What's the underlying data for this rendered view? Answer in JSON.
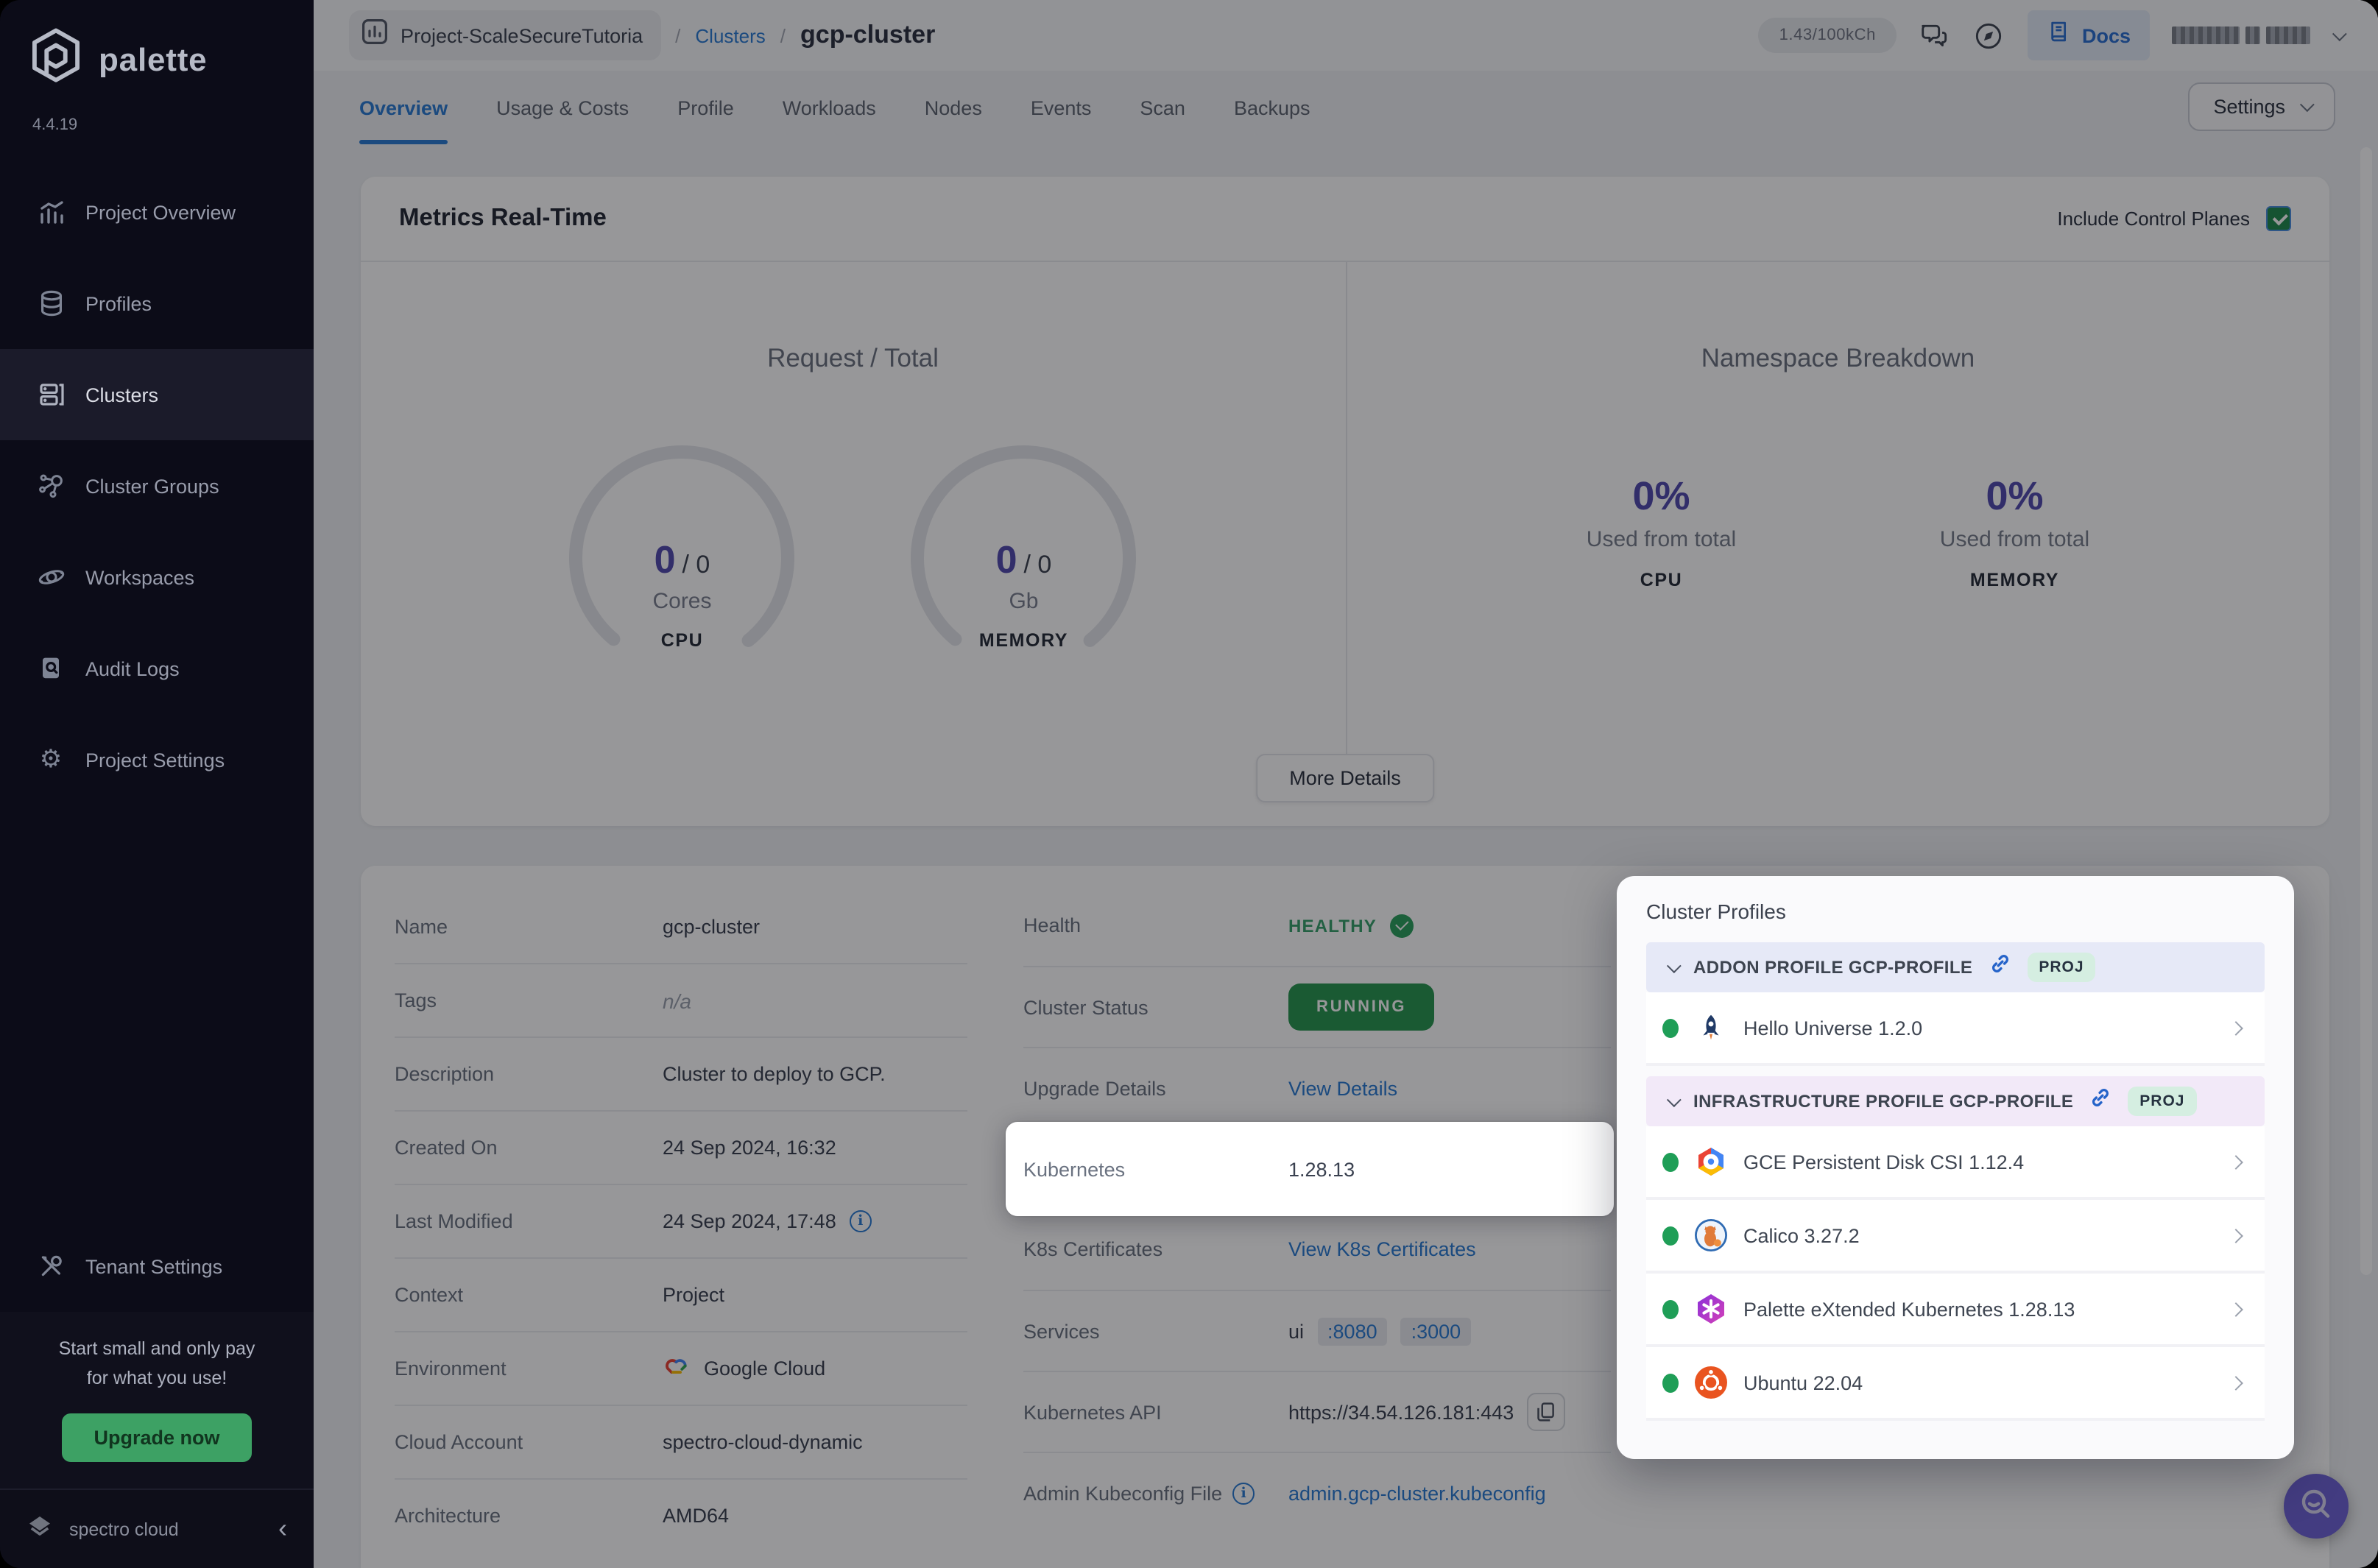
{
  "colors": {
    "accent_blue": "#2a7bd2",
    "brand_purple": "#514aae",
    "healthy_green": "#37a06b",
    "running_badge_green": "#289650",
    "sidebar_bg": "#0c0c18",
    "upgrade_green": "#3da164",
    "fab_purple": "#6e63d6",
    "addon_header_bg": "#e6e9f7",
    "infra_header_bg": "#f2e9f8",
    "proj_badge_bg": "#d5eee1"
  },
  "icons": {
    "fab": "magnifier-with-smile",
    "docs": "book",
    "topbar_left": "bar-chart-in-square",
    "topbar_chat": "chat-bubbles",
    "topbar_help": "compass",
    "kubernetes_api_action": "copy",
    "last_modified": "info-circle",
    "kubeconfig": "info-circle",
    "environment": "google-cloud-logo"
  },
  "brand": {
    "name": "palette",
    "version": "4.4.19",
    "footer": "spectro cloud",
    "collapse_icon": "‹"
  },
  "topbar": {
    "project": "Project-ScaleSecureTutoria",
    "sep1": "/",
    "clusters_link": "Clusters",
    "sep2": "/",
    "page_title": "gcp-cluster",
    "usage": "1.43/100kCh",
    "docs_label": "Docs"
  },
  "tabs": {
    "items": [
      {
        "label": "Overview"
      },
      {
        "label": "Usage & Costs"
      },
      {
        "label": "Profile"
      },
      {
        "label": "Workloads"
      },
      {
        "label": "Nodes"
      },
      {
        "label": "Events"
      },
      {
        "label": "Scan"
      },
      {
        "label": "Backups"
      }
    ],
    "settings_label": "Settings"
  },
  "sidebar": {
    "items": [
      {
        "label": "Project Overview"
      },
      {
        "label": "Profiles"
      },
      {
        "label": "Clusters"
      },
      {
        "label": "Cluster Groups"
      },
      {
        "label": "Workspaces"
      },
      {
        "label": "Audit Logs"
      },
      {
        "label": "Project Settings"
      },
      {
        "label": "Tenant Settings"
      }
    ],
    "promo_line1": "Start small and only pay",
    "promo_line2": "for what you use!",
    "upgrade_label": "Upgrade now"
  },
  "metrics": {
    "title": "Metrics Real-Time",
    "include_label": "Include Control Planes",
    "request_total": {
      "title": "Request / Total",
      "gauges": [
        {
          "used": "0",
          "sep": "/",
          "total": "0",
          "unit": "Cores",
          "metric": "CPU"
        },
        {
          "used": "0",
          "sep": "/",
          "total": "0",
          "unit": "Gb",
          "metric": "MEMORY"
        }
      ]
    },
    "namespace": {
      "title": "Namespace Breakdown",
      "stats": [
        {
          "pct": "0%",
          "caption": "Used from total",
          "metric": "CPU"
        },
        {
          "pct": "0%",
          "caption": "Used from total",
          "metric": "MEMORY"
        }
      ]
    },
    "more_details_label": "More Details"
  },
  "details": {
    "left": {
      "rows": [
        {
          "label": "Name",
          "value": "gcp-cluster"
        },
        {
          "label": "Tags",
          "value": "n/a"
        },
        {
          "label": "Description",
          "value": "Cluster to deploy to GCP."
        },
        {
          "label": "Created On",
          "value": "24 Sep 2024, 16:32"
        },
        {
          "label": "Last Modified",
          "value": "24 Sep 2024, 17:48"
        },
        {
          "label": "Context",
          "value": "Project"
        },
        {
          "label": "Environment",
          "value": "Google Cloud"
        },
        {
          "label": "Cloud Account",
          "value": "spectro-cloud-dynamic"
        },
        {
          "label": "Architecture",
          "value": "AMD64"
        }
      ]
    },
    "right": {
      "rows": [
        {
          "label": "Health",
          "value": "HEALTHY"
        },
        {
          "label": "Cluster Status",
          "value": "RUNNING"
        },
        {
          "label": "Upgrade Details",
          "value": "View Details"
        },
        {
          "label": "Kubernetes",
          "value": "1.28.13"
        },
        {
          "label": "K8s Certificates",
          "value": "View K8s Certificates"
        },
        {
          "label": "Services",
          "value": "ui",
          "ports": [
            ":8080",
            ":3000"
          ]
        },
        {
          "label": "Kubernetes API",
          "value": "https://34.54.126.181:443"
        },
        {
          "label": "Admin Kubeconfig File",
          "value": "admin.gcp-cluster.kubeconfig"
        }
      ]
    }
  },
  "profiles_panel": {
    "title": "Cluster Profiles",
    "addon": {
      "header": "ADDON PROFILE GCP-PROFILE",
      "badge": "PROJ",
      "items": [
        {
          "name": "Hello Universe 1.2.0"
        }
      ]
    },
    "infra": {
      "header": "INFRASTRUCTURE PROFILE GCP-PROFILE",
      "badge": "PROJ",
      "items": [
        {
          "name": "GCE Persistent Disk CSI 1.12.4"
        },
        {
          "name": "Calico 3.27.2"
        },
        {
          "name": "Palette eXtended Kubernetes 1.28.13"
        },
        {
          "name": "Ubuntu 22.04"
        }
      ]
    }
  }
}
